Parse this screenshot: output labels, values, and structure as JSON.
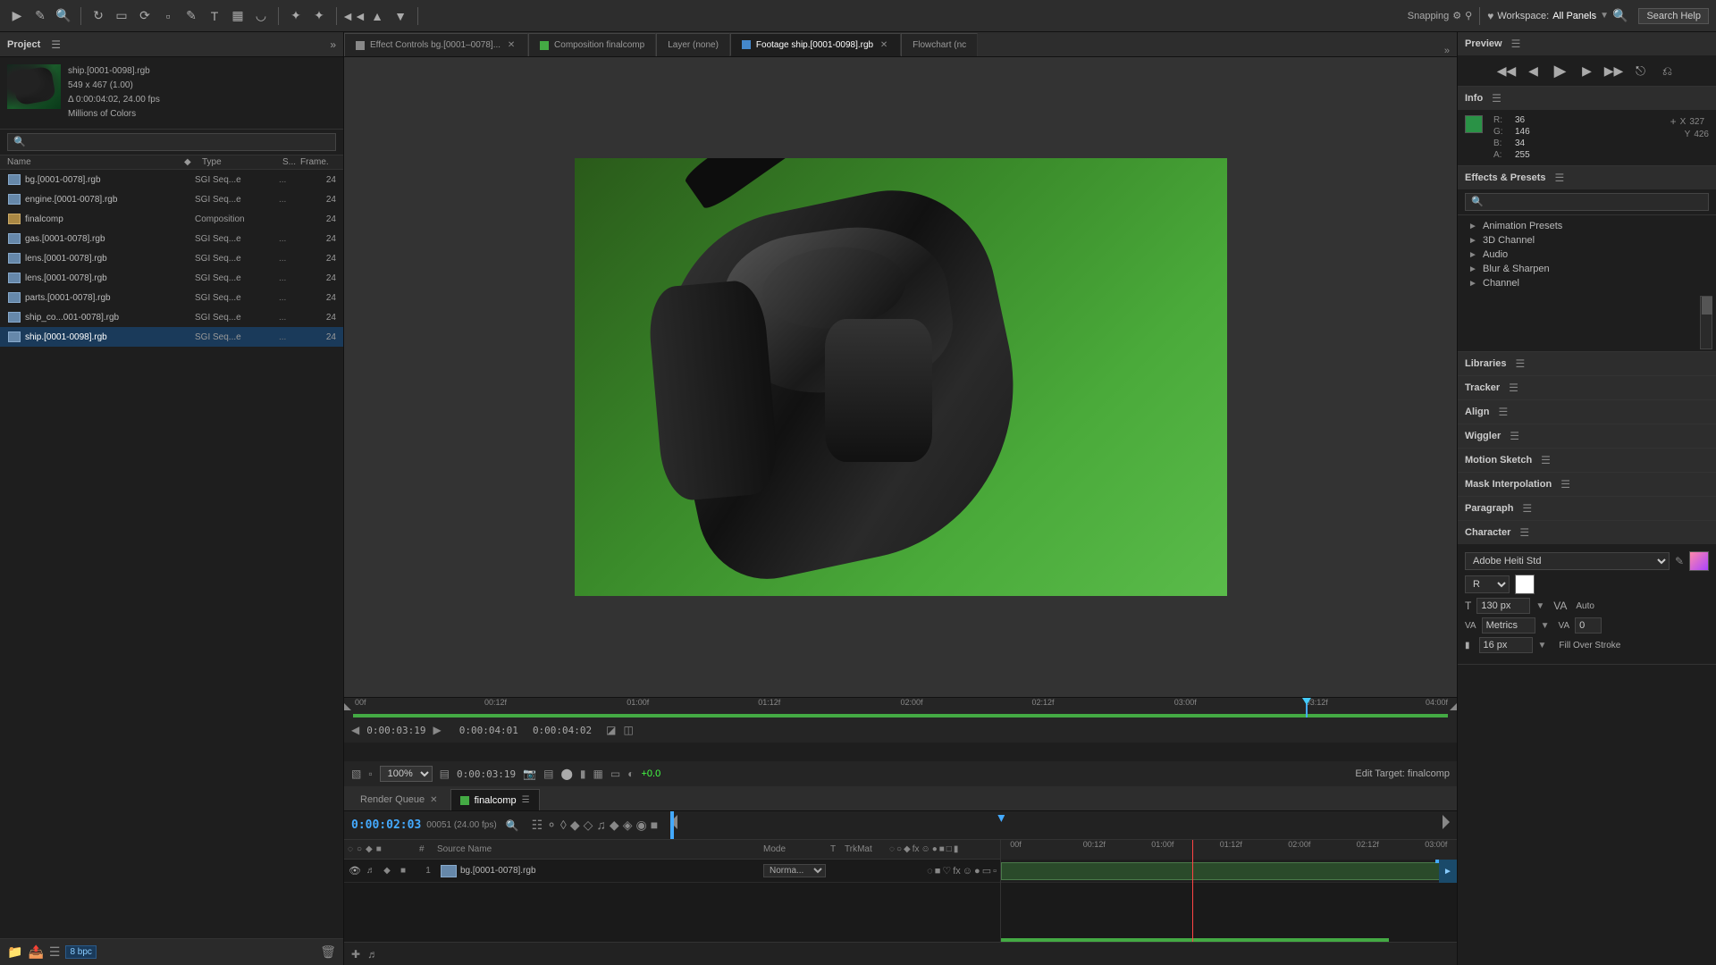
{
  "app": {
    "workspace_label": "Workspace:",
    "workspace_name": "All Panels",
    "search_help_label": "Search Help"
  },
  "toolbar": {
    "snapping_label": "Snapping"
  },
  "project_panel": {
    "title": "Project",
    "thumbnail_name": "ship.[0001-0098].rgb",
    "thumbnail_info_1": "549 x 467 (1.00)",
    "thumbnail_info_2": "Δ 0:00:04:02, 24.00 fps",
    "thumbnail_info_3": "Millions of Colors",
    "search_placeholder": "🔍",
    "columns": {
      "name": "Name",
      "type": "Type",
      "s": "S...",
      "frame": "Frame."
    },
    "files": [
      {
        "id": 1,
        "icon": "footage",
        "name": "bg.[0001-0078].rgb",
        "type": "SGI Seq...e",
        "dots": "...",
        "frames": "24",
        "has_num": false,
        "selected": false
      },
      {
        "id": 2,
        "icon": "footage",
        "name": "engine.[0001-0078].rgb",
        "type": "SGI Seq...e",
        "dots": "...",
        "frames": "24",
        "has_num": false,
        "selected": false
      },
      {
        "id": 3,
        "icon": "comp",
        "name": "finalcomp",
        "type": "Composition",
        "dots": "",
        "frames": "24",
        "has_num": false,
        "selected": false
      },
      {
        "id": 4,
        "icon": "footage",
        "name": "gas.[0001-0078].rgb",
        "type": "SGI Seq...e",
        "dots": "...",
        "frames": "24",
        "has_num": false,
        "selected": false
      },
      {
        "id": 5,
        "icon": "footage",
        "name": "lens.[0001-0078].rgb",
        "type": "SGI Seq...e",
        "dots": "...",
        "frames": "24",
        "has_num": false,
        "selected": false
      },
      {
        "id": 6,
        "icon": "footage",
        "name": "lens.[0001-0078].rgb",
        "type": "SGI Seq...e",
        "dots": "...",
        "frames": "24",
        "has_num": false,
        "selected": false
      },
      {
        "id": 7,
        "icon": "footage",
        "name": "parts.[0001-0078].rgb",
        "type": "SGI Seq...e",
        "dots": "...",
        "frames": "24",
        "has_num": false,
        "selected": false
      },
      {
        "id": 8,
        "icon": "footage",
        "name": "ship_co...001-0078].rgb",
        "type": "SGI Seq...e",
        "dots": "...",
        "frames": "24",
        "has_num": false,
        "selected": false
      },
      {
        "id": 9,
        "icon": "footage",
        "name": "ship.[0001-0098].rgb",
        "type": "SGI Seq...e",
        "dots": "...",
        "frames": "24",
        "has_num": false,
        "selected": true
      }
    ],
    "bpc_label": "8 bpc"
  },
  "viewer_tabs": [
    {
      "label": "Effect Controls bg.[0001–0078]...",
      "active": false,
      "color": "#888888"
    },
    {
      "label": "Composition finalcomp",
      "active": false,
      "color": "#44aa44"
    },
    {
      "label": "Layer (none)",
      "active": false,
      "color": "#888888"
    },
    {
      "label": "Footage ship.[0001-0098].rgb",
      "active": true,
      "color": "#4488cc"
    },
    {
      "label": "Flowchart (nc",
      "active": false,
      "color": "#888888"
    }
  ],
  "viewer": {
    "magnification": "100%",
    "timecode": "0:00:03:19",
    "duration": "0:00:03:19",
    "in_time": "0:00:04:01",
    "out_time": "0:00:04:02",
    "delta_time": "Δ0:00:04:02",
    "plus_value": "+0.0",
    "edit_target": "Edit Target: finalcomp",
    "ruler_marks": [
      "00f",
      "00:12f",
      "01:00f",
      "01:12f",
      "02:00f",
      "02:12f",
      "03:00f",
      "03:12f",
      "04:00f"
    ]
  },
  "timeline": {
    "tabs": [
      {
        "label": "Render Queue",
        "active": false,
        "color": "#888888"
      },
      {
        "label": "finalcomp",
        "active": true,
        "color": "#44aa44"
      }
    ],
    "timecode": "0:00:02:03",
    "fps": "00051 (24.00 fps)",
    "columns": {
      "source_name": "Source Name",
      "mode": "Mode",
      "t": "T",
      "trkmat": "TrkMat"
    },
    "ruler_marks": [
      "00f",
      "00:12f",
      "01:00f",
      "01:12f",
      "02:00f",
      "02:12f",
      "03:00f"
    ],
    "layers": [
      {
        "num": "1",
        "name": "bg.[0001-0078].rgb",
        "mode": "Normal",
        "t": "",
        "trk": ""
      }
    ]
  },
  "right_panel": {
    "preview_title": "Preview",
    "info_title": "Info",
    "info": {
      "r_label": "R:",
      "r_value": "36",
      "g_label": "G:",
      "g_value": "146",
      "b_label": "B:",
      "b_value": "34",
      "a_label": "A:",
      "a_value": "255",
      "x_label": "X",
      "x_value": "327",
      "y_label": "Y",
      "y_value": "426"
    },
    "effects_title": "Effects & Presets",
    "effects_search_placeholder": "🔍",
    "effects_tree": [
      {
        "label": "Animation Presets",
        "arrow": "►"
      },
      {
        "label": "3D Channel",
        "arrow": "►"
      },
      {
        "label": "Audio",
        "arrow": "►"
      },
      {
        "label": "Blur & Sharpen",
        "arrow": "►"
      },
      {
        "label": "Channel",
        "arrow": "►"
      }
    ],
    "libraries_title": "Libraries",
    "tracker_title": "Tracker",
    "align_title": "Align",
    "wiggler_title": "Wiggler",
    "motion_sketch_title": "Motion Sketch",
    "mask_interp_title": "Mask Interpolation",
    "paragraph_title": "Paragraph",
    "character_title": "Character",
    "character": {
      "font_name": "Adobe Heiti Std",
      "font_style": "R",
      "size_label_1": "130 px",
      "size_label_2": "Auto",
      "metric_label": "Metrics",
      "size2_label": "16 px",
      "fill_label": "Fill Over Stroke"
    }
  }
}
